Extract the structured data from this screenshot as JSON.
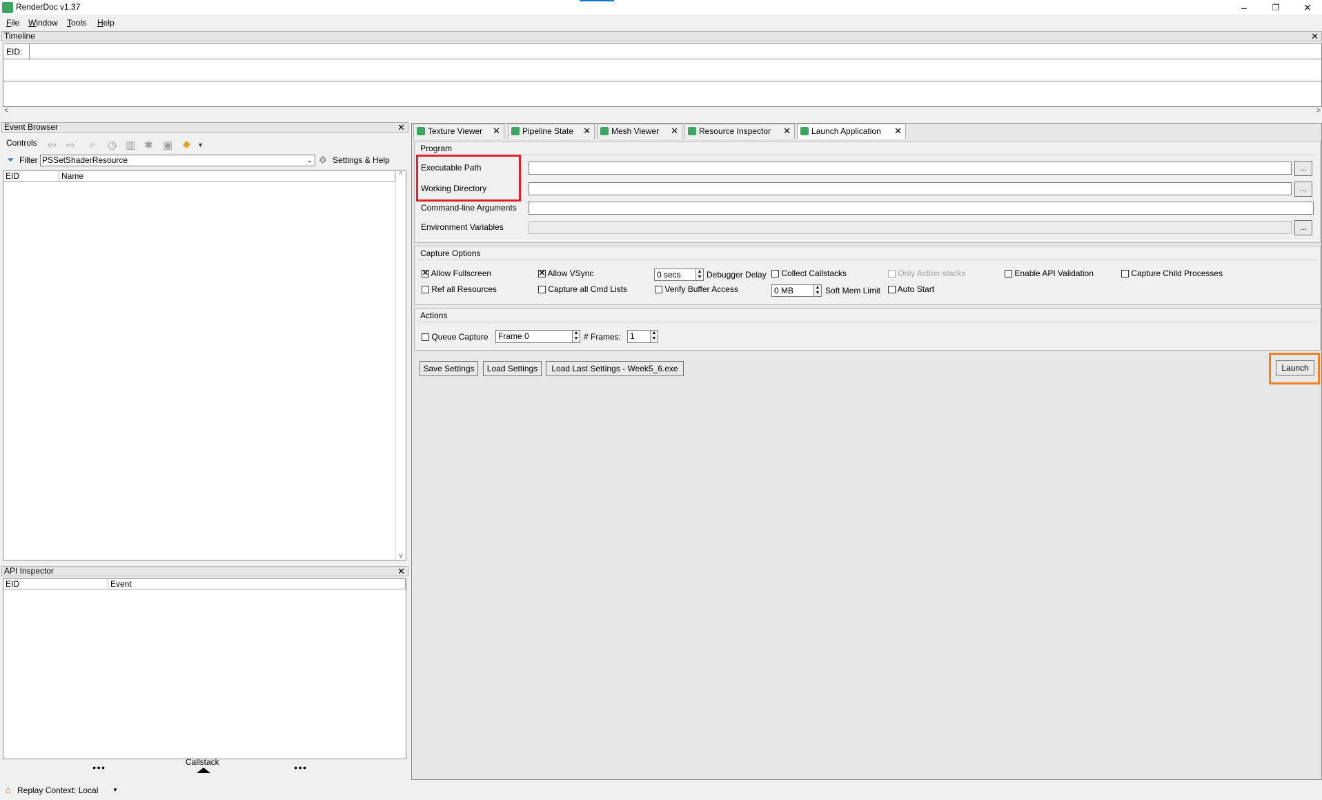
{
  "window": {
    "title": "RenderDoc v1.37",
    "minimize": "–",
    "restore": "❐",
    "close": "✕"
  },
  "menu": [
    "File",
    "Window",
    "Tools",
    "Help"
  ],
  "timeline": {
    "title": "Timeline",
    "eid_label": "EID:"
  },
  "event_browser": {
    "title": "Event Browser",
    "controls_label": "Controls",
    "filter_label": "Filter",
    "filter_value": "PSSetShaderResource",
    "settings_help": "Settings & Help",
    "columns": [
      "EID",
      "Name"
    ]
  },
  "api_inspector": {
    "title": "API Inspector",
    "columns": [
      "EID",
      "Event"
    ],
    "callstack_label": "Callstack",
    "dots": "●●●"
  },
  "status_bar": {
    "replay_context": "Replay Context: Local"
  },
  "tabs": [
    "Texture Viewer",
    "Pipeline State",
    "Mesh Viewer",
    "Resource Inspector",
    "Launch Application"
  ],
  "program": {
    "title": "Program",
    "executable_path": "Executable Path",
    "working_directory": "Working Directory",
    "cmdline_args": "Command-line Arguments",
    "env_vars": "Environment Variables",
    "browse": "..."
  },
  "capture_options": {
    "title": "Capture Options",
    "allow_fullscreen": "Allow Fullscreen",
    "allow_vsync": "Allow VSync",
    "delay_value": "0 secs",
    "debugger_delay": "Debugger Delay",
    "collect_callstacks": "Collect Callstacks",
    "only_action_stacks": "Only Action stacks",
    "enable_api_validation": "Enable API Validation",
    "capture_child_processes": "Capture Child Processes",
    "ref_all_resources": "Ref all Resources",
    "capture_all_cmd_lists": "Capture all Cmd Lists",
    "verify_buffer_access": "Verify Buffer Access",
    "mem_value": "0 MB",
    "soft_mem_limit": "Soft Mem Limit",
    "auto_start": "Auto Start"
  },
  "actions": {
    "title": "Actions",
    "queue_capture": "Queue Capture",
    "frame_value": "Frame 0",
    "frames_label": "# Frames:",
    "frames_value": "1"
  },
  "buttons": {
    "save_settings": "Save Settings",
    "load_settings": "Load Settings",
    "load_last": "Load Last Settings - Week5_6.exe",
    "launch": "Launch"
  },
  "colors": {
    "highlight_red": "#e0202a",
    "highlight_orange": "#f08020",
    "renderdoc_green": "#3aa660"
  }
}
